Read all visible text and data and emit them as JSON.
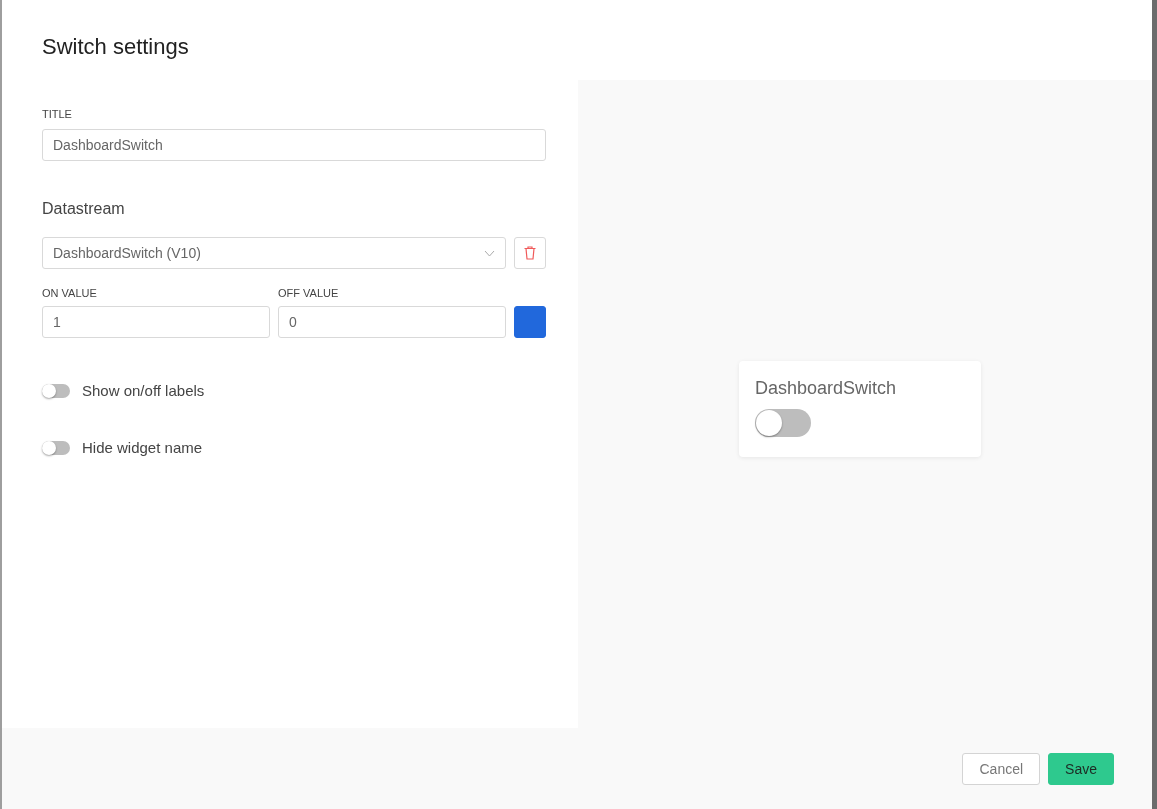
{
  "dialog": {
    "title": "Switch settings"
  },
  "title_field": {
    "label": "TITLE",
    "value": "DashboardSwitch"
  },
  "datastream": {
    "heading": "Datastream",
    "value": "DashboardSwitch (V10)"
  },
  "values": [
    {
      "label": "ON VALUE",
      "value": "1"
    },
    {
      "label": "OFF VALUE",
      "value": "0"
    }
  ],
  "color_picker": {
    "color": "#2168dc"
  },
  "toggles": [
    {
      "label": "Show on/off labels",
      "on": false
    },
    {
      "label": "Hide widget name",
      "on": false
    }
  ],
  "preview": {
    "name": "DashboardSwitch",
    "on": false
  },
  "buttons": [
    {
      "label": "Cancel",
      "kind": "secondary"
    },
    {
      "label": "Save",
      "kind": "primary"
    }
  ]
}
